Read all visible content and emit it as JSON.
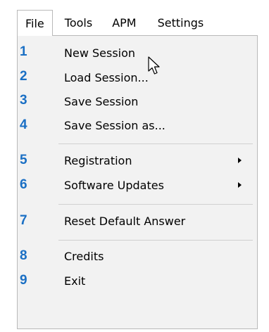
{
  "menubar": {
    "file": "File",
    "tools": "Tools",
    "apm": "APM",
    "settings": "Settings"
  },
  "menu": {
    "items": [
      {
        "number": "1",
        "label": "New Session"
      },
      {
        "number": "2",
        "label": "Load Session..."
      },
      {
        "number": "3",
        "label": "Save Session"
      },
      {
        "number": "4",
        "label": "Save Session as..."
      },
      {
        "number": "5",
        "label": "Registration",
        "submenu": true
      },
      {
        "number": "6",
        "label": "Software Updates",
        "submenu": true
      },
      {
        "number": "7",
        "label": "Reset Default Answer"
      },
      {
        "number": "8",
        "label": "Credits"
      },
      {
        "number": "9",
        "label": "Exit"
      }
    ]
  },
  "colors": {
    "number_badge": "#1a6fc4",
    "menu_background": "#f2f2f2",
    "menu_border": "#b9b9b9"
  },
  "cursor": {
    "icon": "arrow-pointer-icon"
  }
}
